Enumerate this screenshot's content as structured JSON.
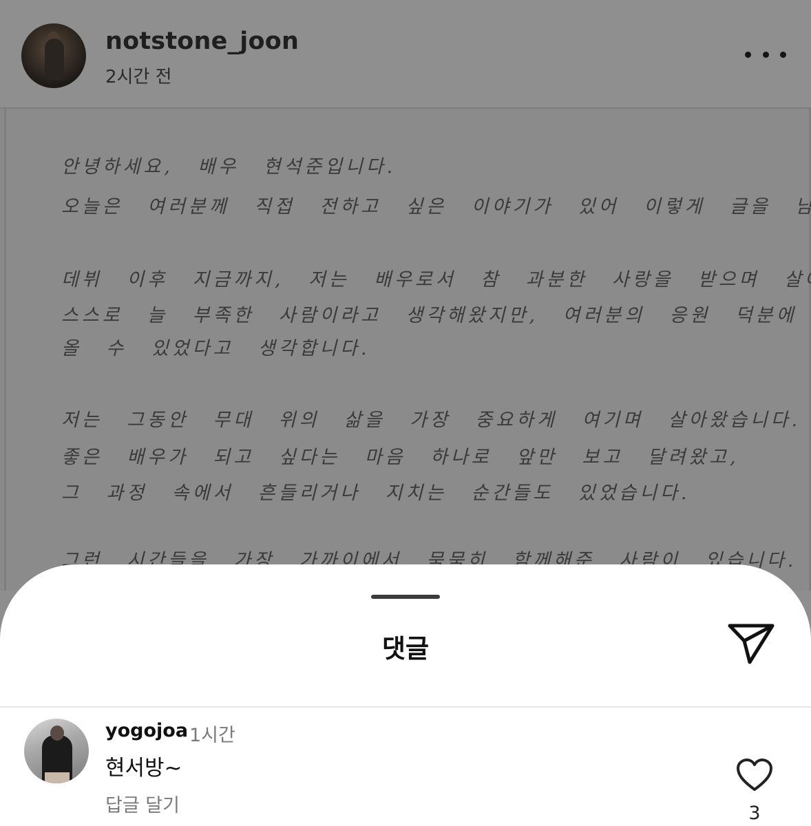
{
  "post": {
    "username": "notstone_joon",
    "time": "2시간 전",
    "more_icon": "more-horizontal-icon",
    "letter_lines": [
      "안녕하세요, 배우 현석준입니다.",
      "오늘은 여러분께 직접 전하고 싶은 이야기가 있어 이렇게 글을 남깁니다.",
      "데뷔 이후 지금까지, 저는 배우로서 참 과분한 사랑을 받으며 살아왔습니다.",
      "스스로 늘 부족한 사람이라고 생각해왔지만, 여러분의 응원 덕분에 여기까지",
      "올 수 있었다고 생각합니다.",
      "저는 그동안 무대 위의 삶을 가장 중요하게 여기며 살아왔습니다.",
      "좋은 배우가 되고 싶다는 마음 하나로 앞만 보고 달려왔고,",
      "그 과정 속에서 흔들리거나 지치는 순간들도 있었습니다.",
      "그런 시간들을 가장 가까이에서 묵묵히 함께해준 사람이 있습니다."
    ]
  },
  "comments_sheet": {
    "title": "댓글",
    "share_icon": "send-icon",
    "comments": [
      {
        "username": "yogojoa",
        "time": "1시간",
        "text": "현서방~",
        "reply_label": "답글 달기",
        "like_icon": "heart-icon",
        "like_count": "3"
      }
    ]
  }
}
